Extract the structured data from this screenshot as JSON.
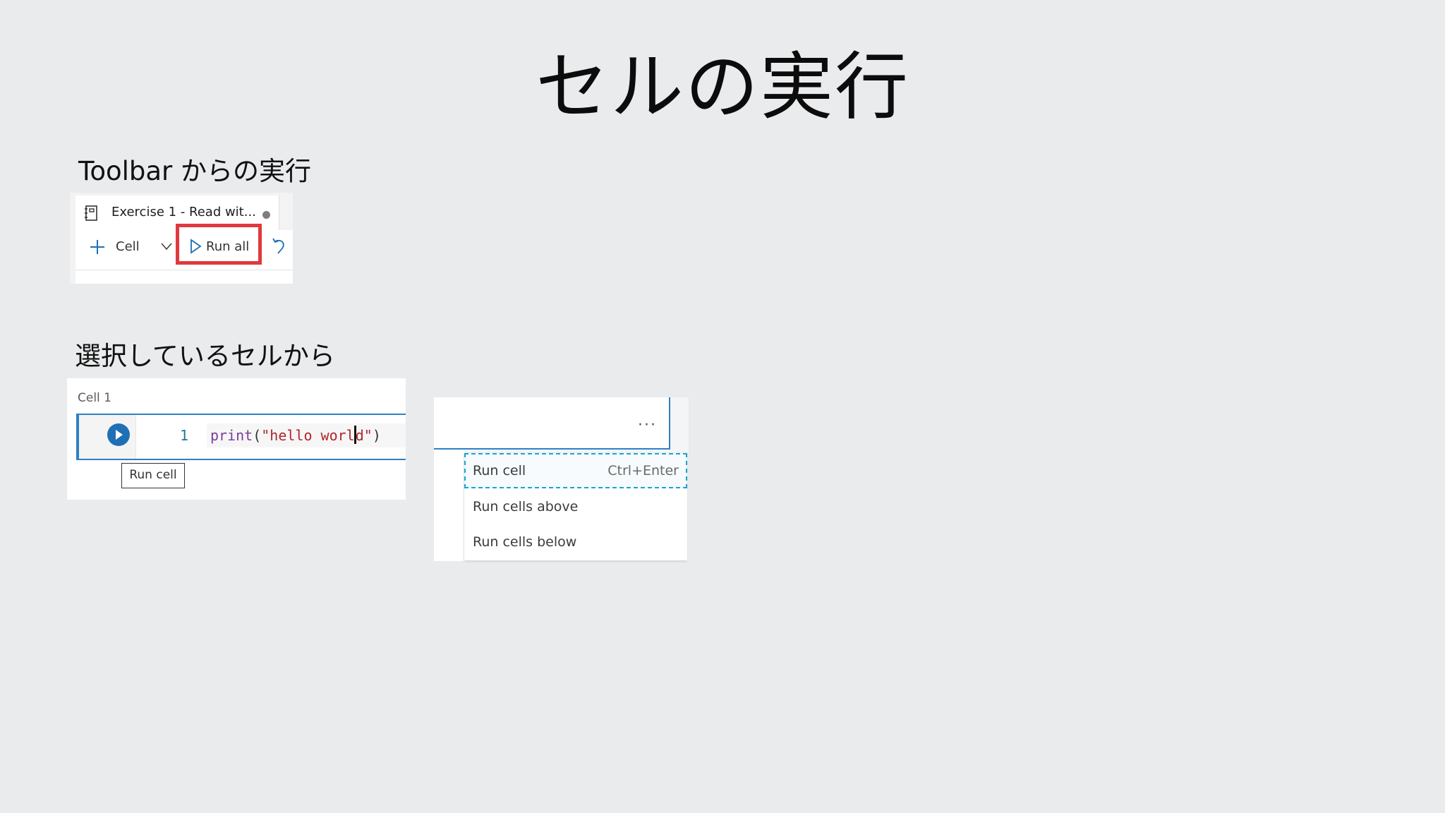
{
  "slide": {
    "title": "セルの実行"
  },
  "toolbar_section": {
    "heading": "Toolbar からの実行",
    "tab_title": "Exercise 1 - Read wit...",
    "add_cell_label": "Cell",
    "run_all_label": "Run all",
    "highlight_color": "#e0393d"
  },
  "cell_section": {
    "heading": "選択しているセルから",
    "cell_label": "Cell 1",
    "line_number": "1",
    "code": {
      "func": "print",
      "open": "(",
      "str_before_caret": "\"hello worl",
      "str_after_caret": "d\"",
      "close": ")"
    },
    "tooltip": "Run cell",
    "accent_color": "#2f80c4"
  },
  "context_menu": {
    "more_icon": "···",
    "items": [
      {
        "label": "Run cell",
        "shortcut": "Ctrl+Enter",
        "focused": true
      },
      {
        "label": "Run cells above",
        "shortcut": ""
      },
      {
        "label": "Run cells below",
        "shortcut": ""
      }
    ]
  }
}
